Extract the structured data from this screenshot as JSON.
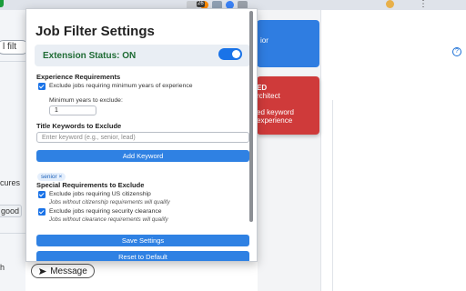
{
  "browser": {
    "extension_badge": "26",
    "colors": {
      "chrome_bg": "#dfe3ea",
      "badge_bg": "#3a3a3a"
    }
  },
  "page_left": {
    "search_partial": "l filt",
    "text_partial_1": "cures",
    "text_partial_2": "good",
    "text_partial_3": "h",
    "message_button": "Message"
  },
  "page_right": {
    "card_blue_partial": "ior",
    "card_red_lines": [
      "ED",
      "rchitect",
      "",
      "ed keyword",
      "experience"
    ],
    "help_icon": "?"
  },
  "popup": {
    "title": "Job Filter Settings",
    "status_label": "Extension Status: ON",
    "status_enabled": true,
    "experience": {
      "heading": "Experience Requirements",
      "checkbox_label": "Exclude jobs requiring minimum years of experience",
      "min_years_label": "Minimum years to exclude:",
      "min_years_value": "1"
    },
    "keywords": {
      "heading": "Title Keywords to Exclude",
      "input_placeholder": "Enter keyword (e.g., senior, lead)",
      "add_button": "Add Keyword",
      "tags": [
        "senior ×"
      ]
    },
    "special": {
      "heading": "Special Requirements to Exclude",
      "citizenship_label": "Exclude jobs requiring US citizenship",
      "citizenship_note": "Jobs without citizenship requirements will qualify",
      "clearance_label": "Exclude jobs requiring security clearance",
      "clearance_note": "Jobs without clearance requirements will qualify"
    },
    "save_button": "Save Settings",
    "reset_button": "Reset to Default",
    "colors": {
      "accent": "#1a73e8",
      "button": "#2f81e3",
      "status_text": "#1e6b34",
      "status_bg": "#e9eef4"
    }
  }
}
